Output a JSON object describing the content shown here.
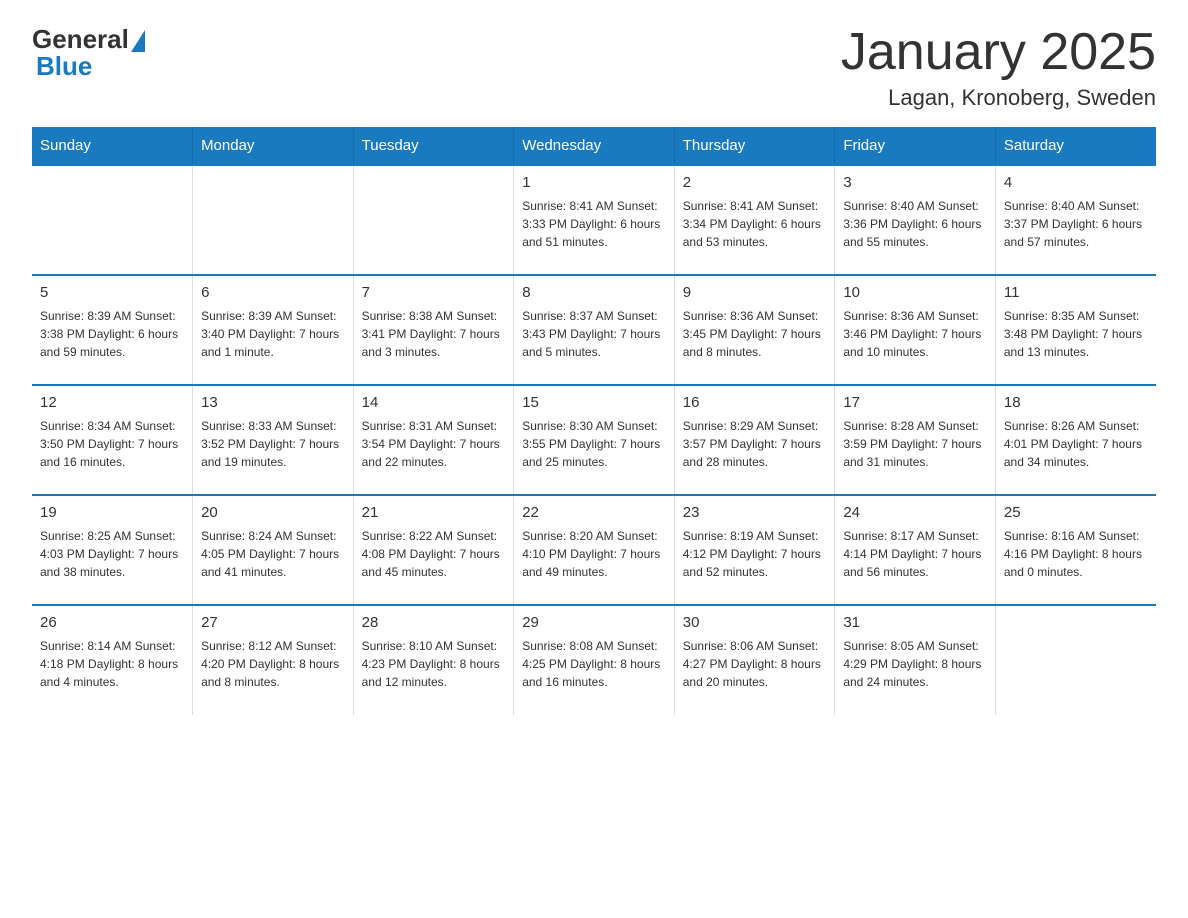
{
  "header": {
    "logo_general": "General",
    "logo_blue": "Blue",
    "title": "January 2025",
    "subtitle": "Lagan, Kronoberg, Sweden"
  },
  "calendar": {
    "weekdays": [
      "Sunday",
      "Monday",
      "Tuesday",
      "Wednesday",
      "Thursday",
      "Friday",
      "Saturday"
    ],
    "rows": [
      [
        {
          "day": "",
          "info": ""
        },
        {
          "day": "",
          "info": ""
        },
        {
          "day": "",
          "info": ""
        },
        {
          "day": "1",
          "info": "Sunrise: 8:41 AM\nSunset: 3:33 PM\nDaylight: 6 hours\nand 51 minutes."
        },
        {
          "day": "2",
          "info": "Sunrise: 8:41 AM\nSunset: 3:34 PM\nDaylight: 6 hours\nand 53 minutes."
        },
        {
          "day": "3",
          "info": "Sunrise: 8:40 AM\nSunset: 3:36 PM\nDaylight: 6 hours\nand 55 minutes."
        },
        {
          "day": "4",
          "info": "Sunrise: 8:40 AM\nSunset: 3:37 PM\nDaylight: 6 hours\nand 57 minutes."
        }
      ],
      [
        {
          "day": "5",
          "info": "Sunrise: 8:39 AM\nSunset: 3:38 PM\nDaylight: 6 hours\nand 59 minutes."
        },
        {
          "day": "6",
          "info": "Sunrise: 8:39 AM\nSunset: 3:40 PM\nDaylight: 7 hours\nand 1 minute."
        },
        {
          "day": "7",
          "info": "Sunrise: 8:38 AM\nSunset: 3:41 PM\nDaylight: 7 hours\nand 3 minutes."
        },
        {
          "day": "8",
          "info": "Sunrise: 8:37 AM\nSunset: 3:43 PM\nDaylight: 7 hours\nand 5 minutes."
        },
        {
          "day": "9",
          "info": "Sunrise: 8:36 AM\nSunset: 3:45 PM\nDaylight: 7 hours\nand 8 minutes."
        },
        {
          "day": "10",
          "info": "Sunrise: 8:36 AM\nSunset: 3:46 PM\nDaylight: 7 hours\nand 10 minutes."
        },
        {
          "day": "11",
          "info": "Sunrise: 8:35 AM\nSunset: 3:48 PM\nDaylight: 7 hours\nand 13 minutes."
        }
      ],
      [
        {
          "day": "12",
          "info": "Sunrise: 8:34 AM\nSunset: 3:50 PM\nDaylight: 7 hours\nand 16 minutes."
        },
        {
          "day": "13",
          "info": "Sunrise: 8:33 AM\nSunset: 3:52 PM\nDaylight: 7 hours\nand 19 minutes."
        },
        {
          "day": "14",
          "info": "Sunrise: 8:31 AM\nSunset: 3:54 PM\nDaylight: 7 hours\nand 22 minutes."
        },
        {
          "day": "15",
          "info": "Sunrise: 8:30 AM\nSunset: 3:55 PM\nDaylight: 7 hours\nand 25 minutes."
        },
        {
          "day": "16",
          "info": "Sunrise: 8:29 AM\nSunset: 3:57 PM\nDaylight: 7 hours\nand 28 minutes."
        },
        {
          "day": "17",
          "info": "Sunrise: 8:28 AM\nSunset: 3:59 PM\nDaylight: 7 hours\nand 31 minutes."
        },
        {
          "day": "18",
          "info": "Sunrise: 8:26 AM\nSunset: 4:01 PM\nDaylight: 7 hours\nand 34 minutes."
        }
      ],
      [
        {
          "day": "19",
          "info": "Sunrise: 8:25 AM\nSunset: 4:03 PM\nDaylight: 7 hours\nand 38 minutes."
        },
        {
          "day": "20",
          "info": "Sunrise: 8:24 AM\nSunset: 4:05 PM\nDaylight: 7 hours\nand 41 minutes."
        },
        {
          "day": "21",
          "info": "Sunrise: 8:22 AM\nSunset: 4:08 PM\nDaylight: 7 hours\nand 45 minutes."
        },
        {
          "day": "22",
          "info": "Sunrise: 8:20 AM\nSunset: 4:10 PM\nDaylight: 7 hours\nand 49 minutes."
        },
        {
          "day": "23",
          "info": "Sunrise: 8:19 AM\nSunset: 4:12 PM\nDaylight: 7 hours\nand 52 minutes."
        },
        {
          "day": "24",
          "info": "Sunrise: 8:17 AM\nSunset: 4:14 PM\nDaylight: 7 hours\nand 56 minutes."
        },
        {
          "day": "25",
          "info": "Sunrise: 8:16 AM\nSunset: 4:16 PM\nDaylight: 8 hours\nand 0 minutes."
        }
      ],
      [
        {
          "day": "26",
          "info": "Sunrise: 8:14 AM\nSunset: 4:18 PM\nDaylight: 8 hours\nand 4 minutes."
        },
        {
          "day": "27",
          "info": "Sunrise: 8:12 AM\nSunset: 4:20 PM\nDaylight: 8 hours\nand 8 minutes."
        },
        {
          "day": "28",
          "info": "Sunrise: 8:10 AM\nSunset: 4:23 PM\nDaylight: 8 hours\nand 12 minutes."
        },
        {
          "day": "29",
          "info": "Sunrise: 8:08 AM\nSunset: 4:25 PM\nDaylight: 8 hours\nand 16 minutes."
        },
        {
          "day": "30",
          "info": "Sunrise: 8:06 AM\nSunset: 4:27 PM\nDaylight: 8 hours\nand 20 minutes."
        },
        {
          "day": "31",
          "info": "Sunrise: 8:05 AM\nSunset: 4:29 PM\nDaylight: 8 hours\nand 24 minutes."
        },
        {
          "day": "",
          "info": ""
        }
      ]
    ]
  }
}
